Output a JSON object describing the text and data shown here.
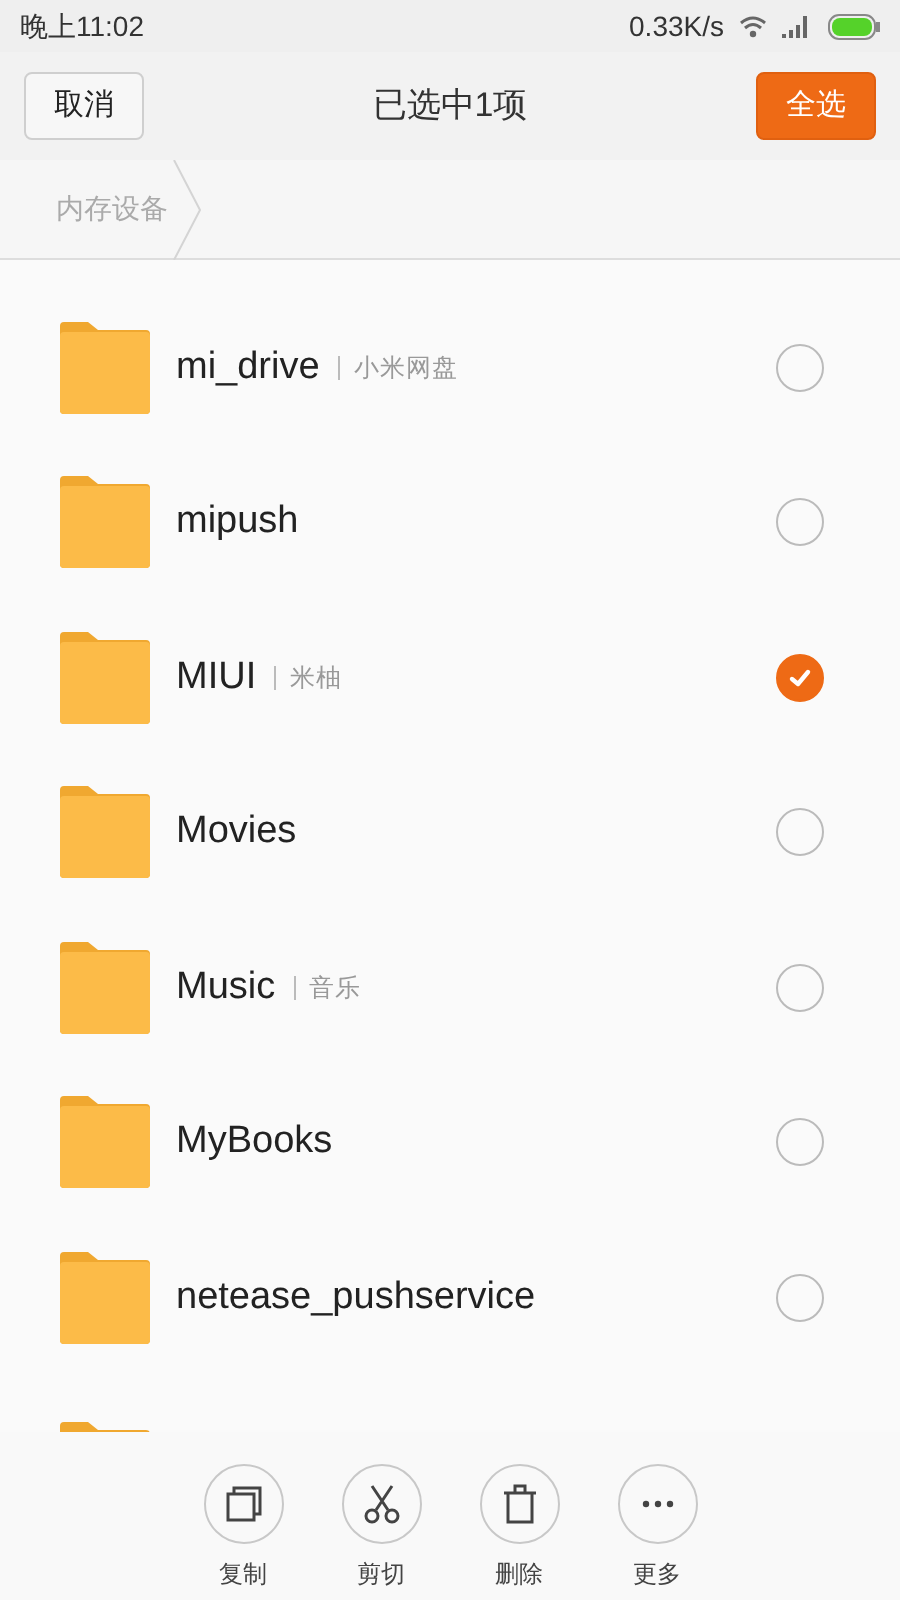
{
  "status_bar": {
    "time": "晚上11:02",
    "speed": "0.33K/s"
  },
  "header": {
    "cancel": "取消",
    "title": "已选中1项",
    "select_all": "全选"
  },
  "breadcrumb": [
    "内存设备"
  ],
  "items": [
    {
      "kind": "folder",
      "name": "mi_drive",
      "note": "小米网盘",
      "selected": false
    },
    {
      "kind": "folder",
      "name": "mipush",
      "selected": false
    },
    {
      "kind": "folder",
      "name": "MIUI",
      "note": "米柚",
      "selected": true
    },
    {
      "kind": "folder",
      "name": "Movies",
      "selected": false
    },
    {
      "kind": "folder",
      "name": "Music",
      "note": "音乐",
      "selected": false
    },
    {
      "kind": "folder",
      "name": "MyBooks",
      "selected": false
    },
    {
      "kind": "folder",
      "name": "netease_pushservice",
      "selected": false
    },
    {
      "kind": "cut-off"
    }
  ],
  "actions": [
    {
      "kind": "copy",
      "label": "复制"
    },
    {
      "kind": "cut",
      "label": "剪切"
    },
    {
      "kind": "delete",
      "label": "删除"
    },
    {
      "kind": "more",
      "label": "更多"
    }
  ]
}
